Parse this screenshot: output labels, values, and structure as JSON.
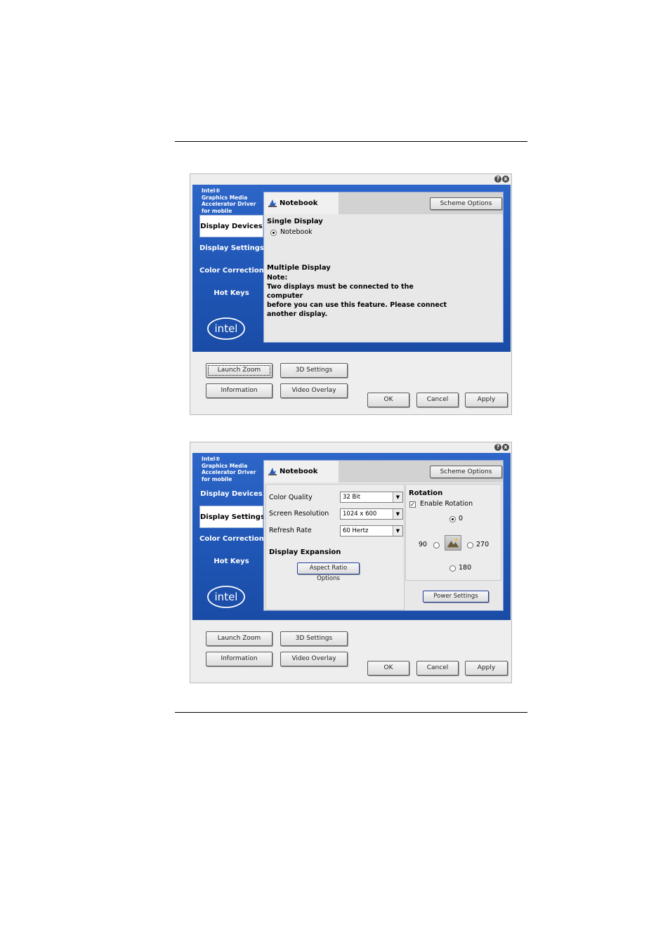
{
  "common": {
    "brand": [
      "Intel®",
      "Graphics Media",
      "Accelerator Driver",
      "for mobile"
    ],
    "nav": [
      "Display Devices",
      "Display Settings",
      "Color Correction",
      "Hot Keys"
    ],
    "tab_label": "Notebook",
    "scheme_options": "Scheme Options",
    "launch_zoom": "Launch Zoom",
    "settings_3d": "3D Settings",
    "information": "Information",
    "video_overlay": "Video Overlay",
    "ok": "OK",
    "cancel": "Cancel",
    "apply": "Apply",
    "help_icon": "?",
    "close_icon": "x",
    "logo_text": "intel"
  },
  "window1": {
    "active_nav": "Display Devices",
    "single_display_heading": "Single Display",
    "single_display_option": "Notebook",
    "multiple_display_heading": "Multiple Display",
    "note_label": "Note:",
    "note_lines": [
      "Two displays must be connected to the computer",
      "before you can use this feature.  Please connect",
      "another display."
    ]
  },
  "window2": {
    "active_nav": "Display Settings",
    "color_quality_label": "Color Quality",
    "color_quality_value": "32 Bit",
    "screen_resolution_label": "Screen Resolution",
    "screen_resolution_value": "1024 x 600",
    "refresh_rate_label": "Refresh Rate",
    "refresh_rate_value": "60 Hertz",
    "display_expansion_heading": "Display Expansion",
    "aspect_ratio_button": "Aspect Ratio Options",
    "rotation_heading": "Rotation",
    "enable_rotation": "Enable Rotation",
    "rotation_enabled": true,
    "rot_0": "0",
    "rot_90": "90",
    "rot_180": "180",
    "rot_270": "270",
    "selected_rotation": "0",
    "power_settings": "Power Settings"
  }
}
